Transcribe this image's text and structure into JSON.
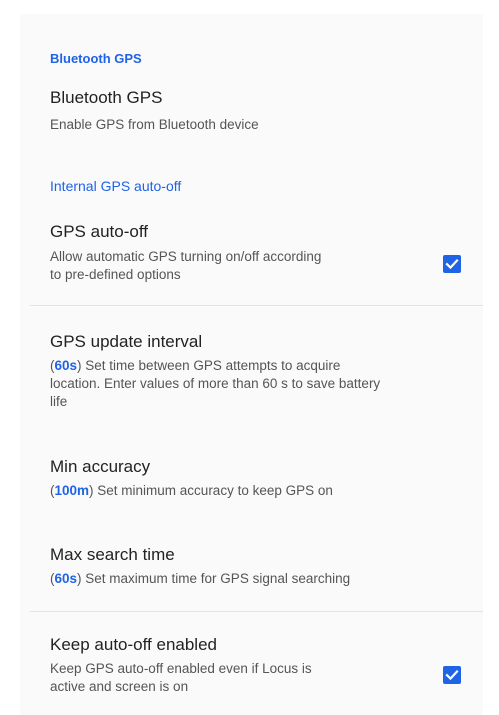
{
  "categories": {
    "bluetooth": "Bluetooth GPS",
    "internal": "Internal GPS auto-off"
  },
  "prefs": {
    "bluetooth_gps": {
      "title": "Bluetooth GPS",
      "summary": "Enable GPS from Bluetooth device"
    },
    "gps_auto_off": {
      "title": "GPS auto-off",
      "summary_line1": "Allow automatic GPS turning on/off according",
      "summary_line2": "to pre-defined options",
      "checked": true
    },
    "update_interval": {
      "title": "GPS update interval",
      "value": "60s",
      "summary_line1_rest": " Set time between GPS attempts to acquire",
      "summary_line2": "location. Enter values of more than 60 s to save battery",
      "summary_line3": "life"
    },
    "min_accuracy": {
      "title": "Min accuracy",
      "value": "100m",
      "summary_rest": " Set minimum accuracy to keep GPS on"
    },
    "max_search_time": {
      "title": "Max search time",
      "value": "60s",
      "summary_rest": " Set maximum time for GPS signal searching"
    },
    "keep_auto_off": {
      "title": "Keep auto-off enabled",
      "summary_line1": "Keep GPS auto-off enabled even if Locus is",
      "summary_line2": "active and screen is on",
      "checked": true
    }
  },
  "colors": {
    "accent": "#1f63e6",
    "title_text": "#222222",
    "summary_text": "#555555",
    "divider": "#e3e3e3"
  },
  "icons": {
    "checkbox": "check-icon"
  }
}
